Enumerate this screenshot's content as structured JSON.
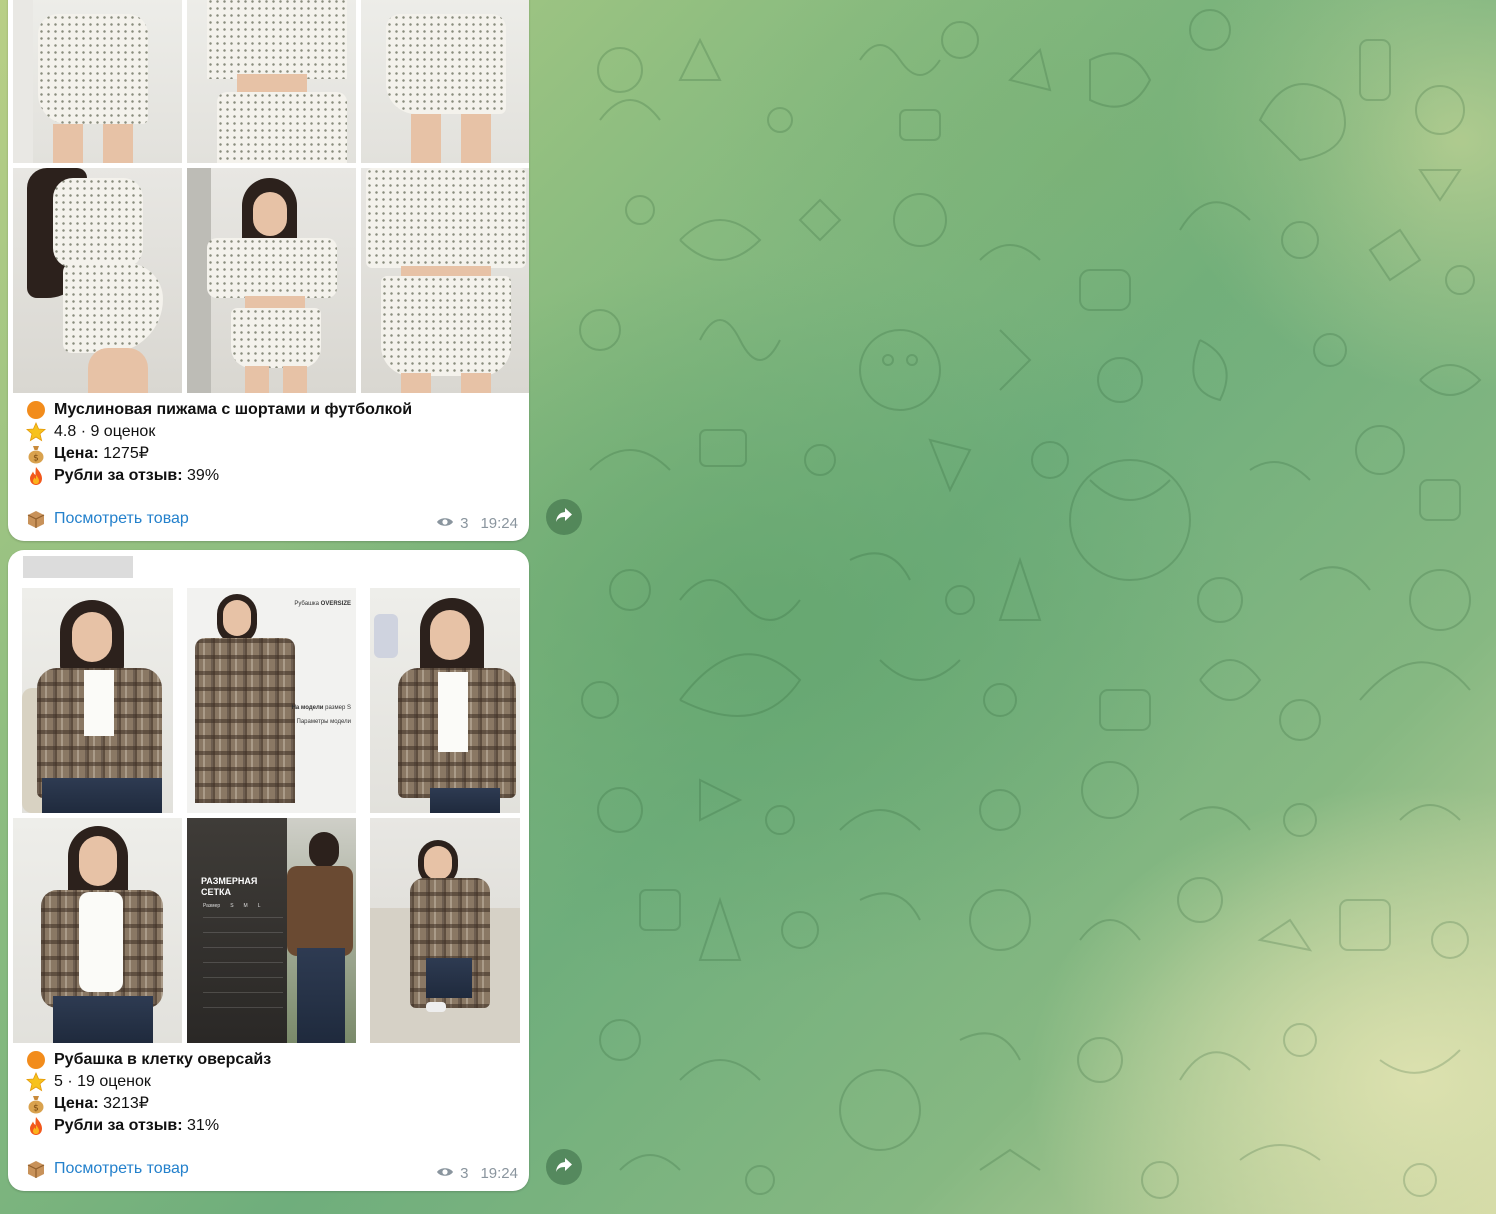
{
  "messages": [
    {
      "title": "Муслиновая пижама с шортами и футболкой",
      "rating": "4.8 · 9 оценок",
      "price_label": "Цена:",
      "price_value": "1275₽",
      "cashback_label": "Рубли за отзыв:",
      "cashback_value": "39%",
      "link_label": "Посмотреть товар",
      "views": "3",
      "time": "19:24",
      "icons": [
        "orange-circle",
        "star",
        "money-bag",
        "fire",
        "package"
      ]
    },
    {
      "title": "Рубашка в клетку оверсайз",
      "rating": "5 · 19 оценок",
      "price_label": "Цена:",
      "price_value": "3213₽",
      "cashback_label": "Рубли за отзыв:",
      "cashback_value": "31%",
      "link_label": "Посмотреть товар",
      "views": "3",
      "time": "19:24",
      "icons": [
        "orange-circle",
        "star",
        "money-bag",
        "fire",
        "package"
      ],
      "size_chart": {
        "title_line1": "РАЗМЕРНАЯ",
        "title_line2": "СЕТКА",
        "columns": [
          "Размер",
          "S",
          "M",
          "L"
        ]
      },
      "shirt_promo": {
        "headline_prefix": "Рубашка",
        "headline_bold": "OVERSIZE",
        "model_label": "На модели",
        "model_size": "размер S",
        "params_label": "Параметры модели"
      }
    }
  ]
}
